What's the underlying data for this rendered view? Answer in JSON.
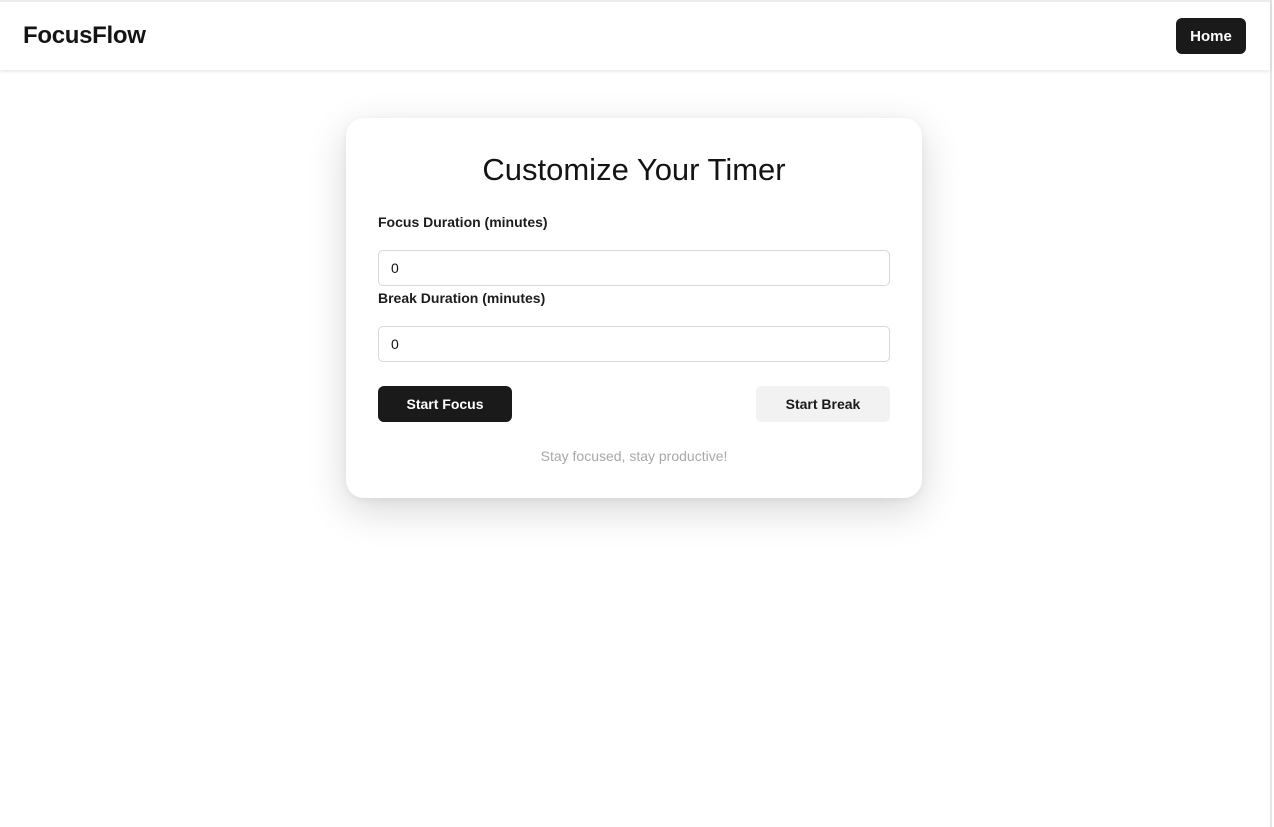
{
  "nav": {
    "brand": "FocusFlow",
    "home_label": "Home"
  },
  "card": {
    "title": "Customize Your Timer",
    "focus": {
      "label": "Focus Duration (minutes)",
      "value": "0"
    },
    "break": {
      "label": "Break Duration (minutes)",
      "value": "0"
    },
    "start_focus_label": "Start Focus",
    "start_break_label": "Start Break",
    "tagline": "Stay focused, stay productive!"
  },
  "colors": {
    "primary_button": "#1a1a1a",
    "secondary_button": "#f2f2f2",
    "tagline_text": "#a8a8a8"
  }
}
